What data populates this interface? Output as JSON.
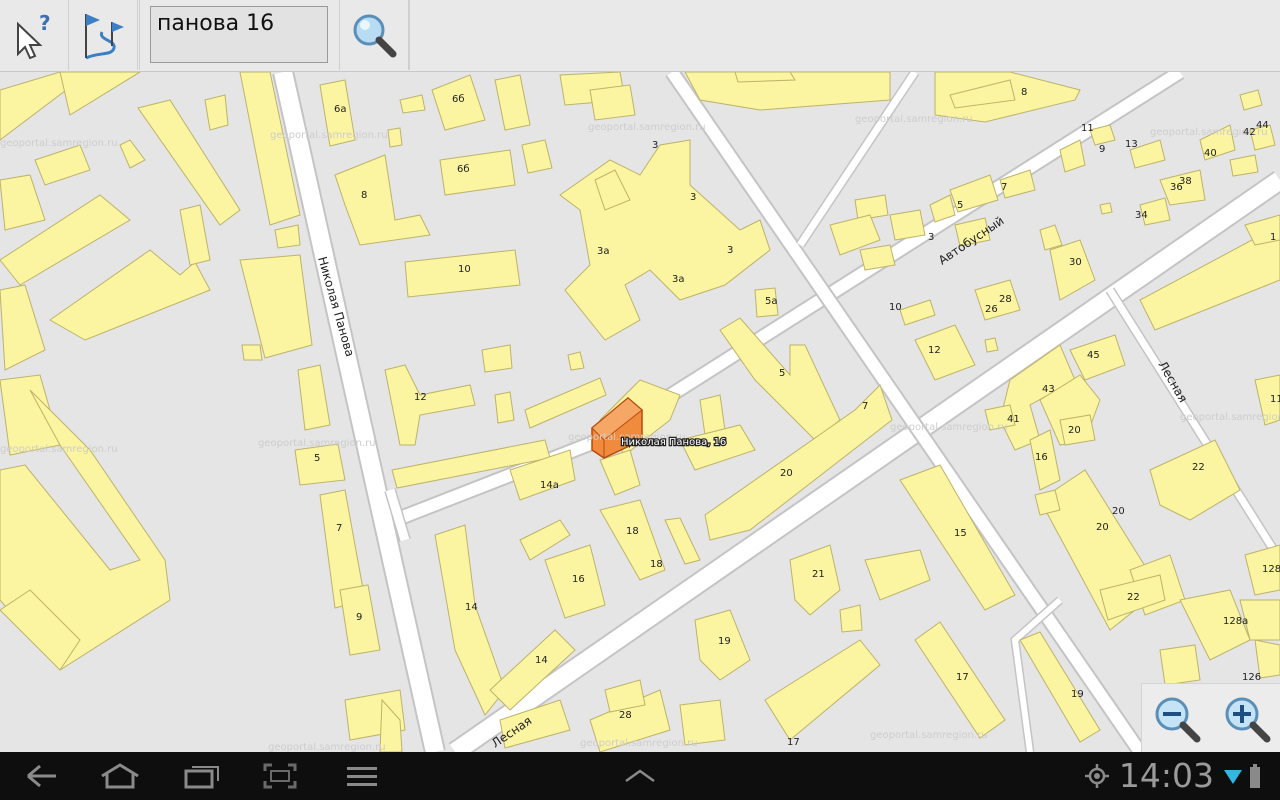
{
  "toolbar": {
    "help_icon": "cursor-help-icon",
    "route_icon": "route-flags-icon",
    "search_value": "панова 16",
    "search_icon": "magnifier-icon"
  },
  "map": {
    "selected_label": "Николая Панова, 16",
    "streets": {
      "nikolaya_panova": "Николая Панова",
      "avtobusny": "Автобусный",
      "lesnaya_1": "Лесная",
      "lesnaya_2": "Лесная"
    },
    "watermark": "geoportal.samregion.ru",
    "house_numbers": [
      "6а",
      "6б",
      "6б",
      "8",
      "10",
      "3",
      "3",
      "3",
      "3а",
      "3а",
      "5а",
      "5",
      "7",
      "12",
      "5",
      "7",
      "9",
      "14а",
      "18",
      "18",
      "16",
      "14",
      "14",
      "20",
      "19",
      "21",
      "28",
      "17",
      "15",
      "17",
      "19",
      "11",
      "9",
      "13",
      "40",
      "42",
      "44",
      "38",
      "36",
      "34",
      "7",
      "5",
      "3",
      "30",
      "28",
      "26",
      "10",
      "12",
      "45",
      "43",
      "41",
      "20",
      "16",
      "20",
      "20",
      "22",
      "22",
      "128",
      "128а",
      "126",
      "8",
      "1",
      "11"
    ]
  },
  "zoom": {
    "out_icon": "zoom-out-icon",
    "in_icon": "zoom-in-icon"
  },
  "systembar": {
    "back_icon": "back-icon",
    "home_icon": "home-icon",
    "recent_icon": "recent-apps-icon",
    "screenshot_icon": "screenshot-icon",
    "menu_icon": "menu-icon",
    "up_icon": "chevron-up-icon",
    "gps_icon": "gps-icon",
    "time": "14:03",
    "wifi_icon": "wifi-icon",
    "battery_icon": "battery-icon"
  }
}
